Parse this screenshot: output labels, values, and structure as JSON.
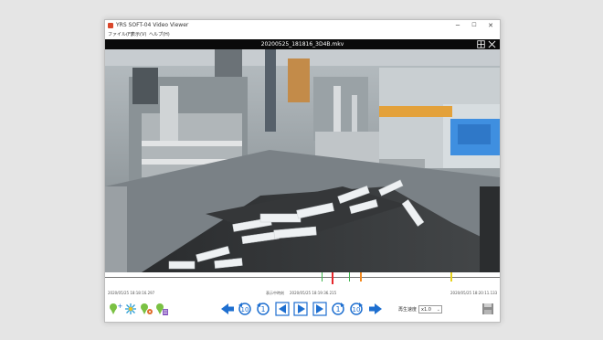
{
  "window": {
    "title": "YRS SOFT-04 Video Viewer"
  },
  "window_controls": {
    "minimize": "─",
    "maximize": "☐",
    "close": "✕"
  },
  "menu": [
    {
      "label": "ファイル(F)"
    },
    {
      "label": "表示(V)"
    },
    {
      "label": "ヘルプ(H)"
    }
  ],
  "video": {
    "file_name": "20200525_181816_3D4B.mkv"
  },
  "timeline": {
    "markers": [
      {
        "position": 0.548,
        "color": "#3cb44b"
      },
      {
        "position": 0.573,
        "color": "#e6262b"
      },
      {
        "position": 0.617,
        "color": "#3cb44b"
      },
      {
        "position": 0.646,
        "color": "#f58a1f"
      },
      {
        "position": 0.876,
        "color": "#e8d21c"
      }
    ],
    "start_time": "2020/05/25 18:18:16.297",
    "current_label": "表示中時刻",
    "current_time": "2020/05/25 18:19:36.215",
    "end_time": "2020/05/25 18:20:11.133"
  },
  "playback": {
    "speed_label": "再生速度",
    "speed_value": "x1.0"
  },
  "tools": [
    {
      "name": "add-marker",
      "icon": "pin-plus-icon"
    },
    {
      "name": "snapshot",
      "icon": "snowflake-icon"
    },
    {
      "name": "marker-settings",
      "icon": "pin-gear-icon"
    },
    {
      "name": "marker-list",
      "icon": "pin-list-icon"
    }
  ],
  "colors": {
    "accent": "#1e6fd0",
    "video_header": "#0a0a0a"
  }
}
